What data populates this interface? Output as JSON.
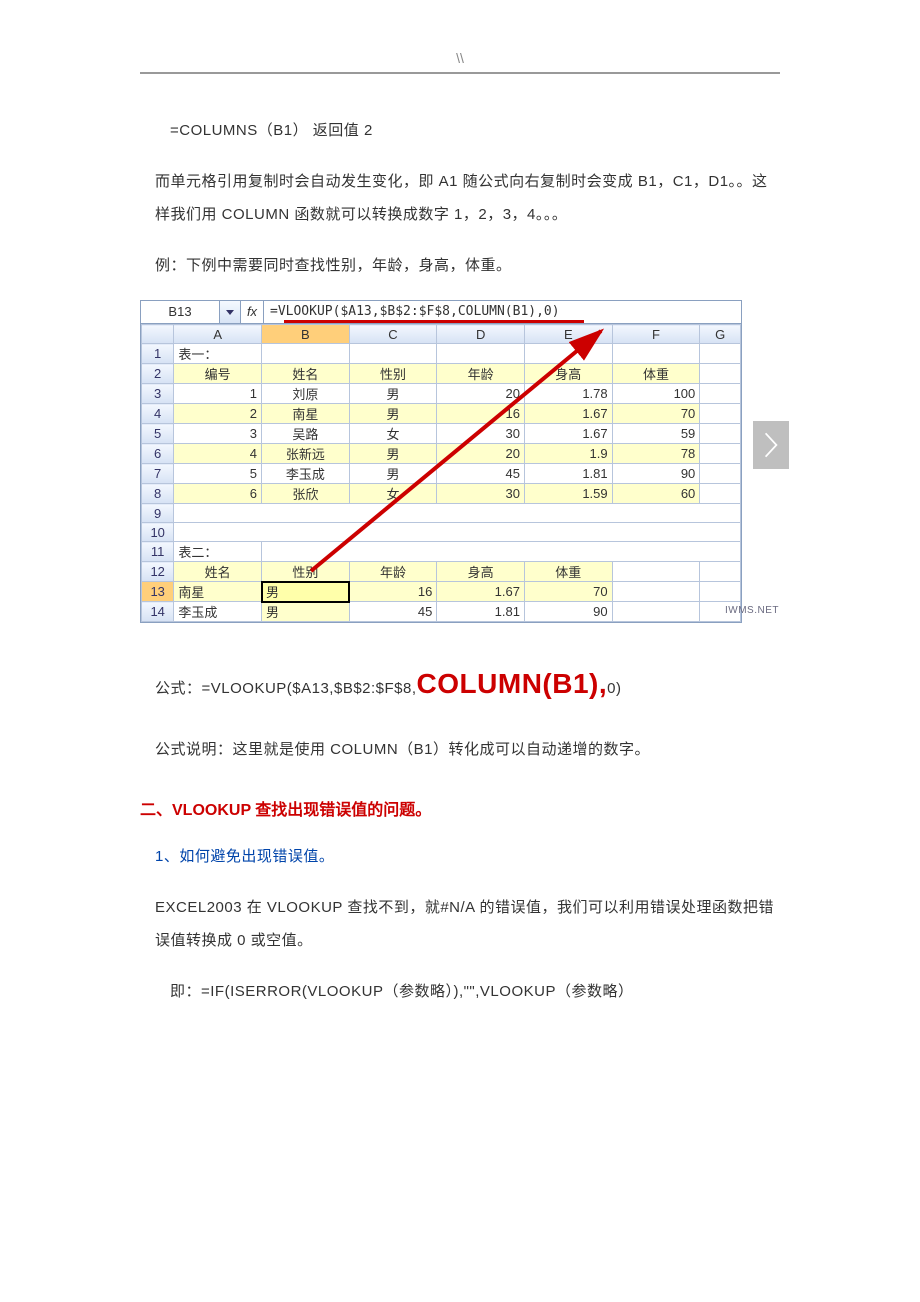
{
  "header": {
    "mark": "\\\\"
  },
  "paragraphs": {
    "p1": "=COLUMNS（B1）  返回值 2",
    "p2": "而单元格引用复制时会自动发生变化，即 A1 随公式向右复制时会变成 B1，C1，D1。。这样我们用 COLUMN 函数就可以转换成数字 1，2，3，4。。。",
    "p3": "例：下例中需要同时查找性别，年龄，身高，体重。",
    "p4_a": "公式：=VLOOKUP($A13,$B$2:$F$8,",
    "p4_b": "COLUMN(B1),",
    "p4_c": "0)",
    "p5": "公式说明：这里就是使用 COLUMN（B1）转化成可以自动递增的数字。",
    "h2": "二、VLOOKUP 查找出现错误值的问题。",
    "p6": "1、如何避免出现错误值。",
    "p7": "EXCEL2003 在 VLOOKUP 查找不到，就#N/A 的错误值，我们可以利用错误处理函数把错误值转换成 0 或空值。",
    "p8": "即：=IF(ISERROR(VLOOKUP（参数略）),\"\",VLOOKUP（参数略）"
  },
  "excel": {
    "name_box": "B13",
    "fx": "fx",
    "formula": "=VLOOKUP($A13,$B$2:$F$8,COLUMN(B1),0)",
    "columns": [
      "A",
      "B",
      "C",
      "D",
      "E",
      "F",
      "G"
    ],
    "rows": [
      "1",
      "2",
      "3",
      "4",
      "5",
      "6",
      "7",
      "8",
      "9",
      "10",
      "11",
      "12",
      "13",
      "14"
    ],
    "t1_label": "表一：",
    "t1_headers": [
      "编号",
      "姓名",
      "性别",
      "年龄",
      "身高",
      "体重"
    ],
    "t1_data": [
      [
        "1",
        "刘原",
        "男",
        "20",
        "1.78",
        "100"
      ],
      [
        "2",
        "南星",
        "男",
        "16",
        "1.67",
        "70"
      ],
      [
        "3",
        "吴路",
        "女",
        "30",
        "1.67",
        "59"
      ],
      [
        "4",
        "张新远",
        "男",
        "20",
        "1.9",
        "78"
      ],
      [
        "5",
        "李玉成",
        "男",
        "45",
        "1.81",
        "90"
      ],
      [
        "6",
        "张欣",
        "女",
        "30",
        "1.59",
        "60"
      ]
    ],
    "t2_label": "表二：",
    "t2_headers": [
      "姓名",
      "性别",
      "年龄",
      "身高",
      "体重"
    ],
    "t2_data": [
      [
        "南星",
        "男",
        "16",
        "1.67",
        "70"
      ],
      [
        "李玉成",
        "男",
        "45",
        "1.81",
        "90"
      ]
    ],
    "watermark": "IWMS.NET"
  }
}
